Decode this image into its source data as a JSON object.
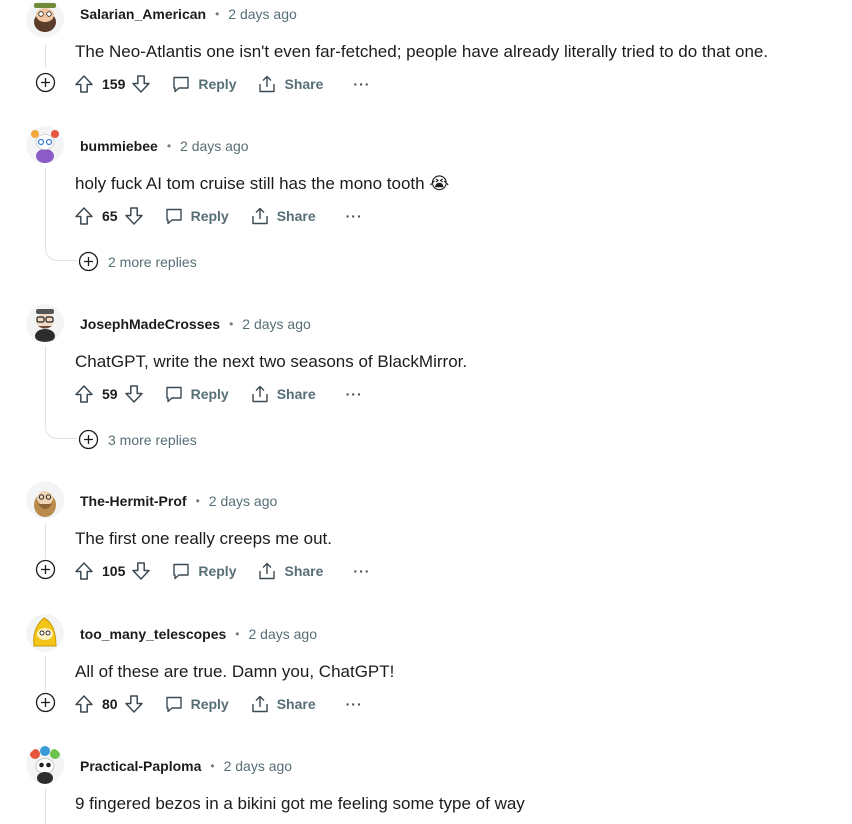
{
  "comments": [
    {
      "username": "Salarian_American",
      "time": "2 days ago",
      "text": "The Neo-Atlantis one isn't even far-fetched; people have already literally tried to do that one.",
      "votes": "159",
      "reply_label": "Reply",
      "share_label": "Share",
      "more_label": "···"
    },
    {
      "username": "bummiebee",
      "time": "2 days ago",
      "text": "holy fuck AI tom cruise still has the mono tooth 😭",
      "votes": "65",
      "reply_label": "Reply",
      "share_label": "Share",
      "more_label": "···",
      "more_replies": "2 more replies"
    },
    {
      "username": "JosephMadeCrosses",
      "time": "2 days ago",
      "text": "ChatGPT, write the next two seasons of BlackMirror.",
      "votes": "59",
      "reply_label": "Reply",
      "share_label": "Share",
      "more_label": "···",
      "more_replies": "3 more replies"
    },
    {
      "username": "The-Hermit-Prof",
      "time": "2 days ago",
      "text": "The first one really creeps me out.",
      "votes": "105",
      "reply_label": "Reply",
      "share_label": "Share",
      "more_label": "···"
    },
    {
      "username": "too_many_telescopes",
      "time": "2 days ago",
      "text": "All of these are true. Damn you, ChatGPT!",
      "votes": "80",
      "reply_label": "Reply",
      "share_label": "Share",
      "more_label": "···"
    },
    {
      "username": "Practical-Paploma",
      "time": "2 days ago",
      "text": "9 fingered bezos in a bikini got me feeling some type of way"
    }
  ],
  "separator": "•",
  "icons": {
    "upvote": "upvote-arrow-icon",
    "downvote": "downvote-arrow-icon",
    "reply": "speech-bubble-icon",
    "share": "share-upload-icon",
    "expand": "plus-circle-icon"
  },
  "colors": {
    "username": "#1c1c1c",
    "meta": "#576f76",
    "action": "#576f76",
    "thread_line": "#dfe3e6"
  }
}
